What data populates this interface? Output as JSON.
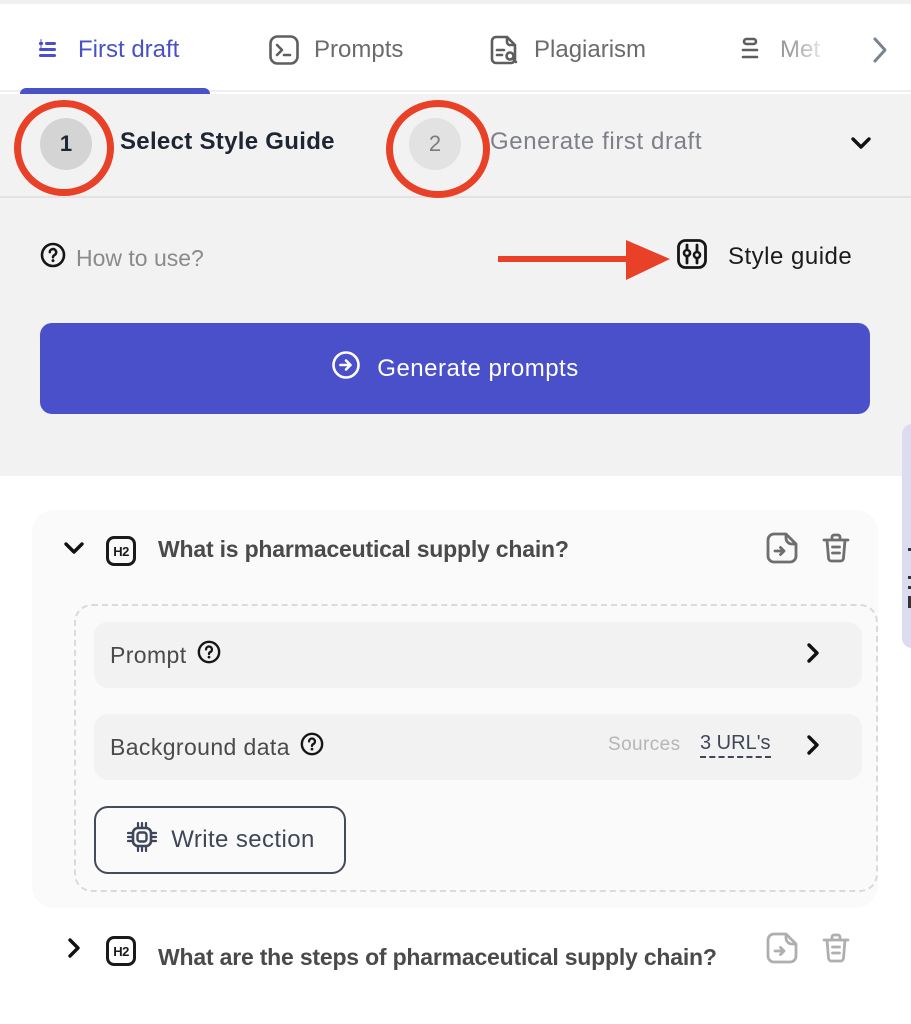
{
  "tabs": {
    "items": [
      {
        "label": "First draft",
        "icon": "list-icon",
        "active": true
      },
      {
        "label": "Prompts",
        "icon": "terminal-icon",
        "active": false
      },
      {
        "label": "Plagiarism",
        "icon": "document-search-icon",
        "active": false
      },
      {
        "label": "Met",
        "icon": "metrics-icon",
        "active": false
      }
    ],
    "next_icon": "chevron-right-icon"
  },
  "stepper": {
    "steps": [
      {
        "number": "1",
        "label": "Select Style Guide",
        "active": true
      },
      {
        "number": "2",
        "label": "Generate first draft",
        "active": false
      }
    ],
    "toggle_icon": "chevron-down-icon"
  },
  "help": {
    "how_to_use": "How to use?",
    "style_guide": "Style guide"
  },
  "generate_button": {
    "label": "Generate prompts",
    "icon": "arrow-circle-right-icon"
  },
  "colors": {
    "accent": "#4a50ca",
    "annotation": "#e84127"
  },
  "sections": [
    {
      "tag": "H2",
      "title": "What is pharmaceutical supply chain?",
      "expanded": true,
      "rows": {
        "prompt_label": "Prompt",
        "background_label": "Background data",
        "sources_label": "Sources",
        "sources_value": "3 URL's"
      },
      "write_button": "Write section"
    },
    {
      "tag": "H2",
      "title": "What are the steps of pharmaceutical supply chain?",
      "expanded": false
    }
  ]
}
